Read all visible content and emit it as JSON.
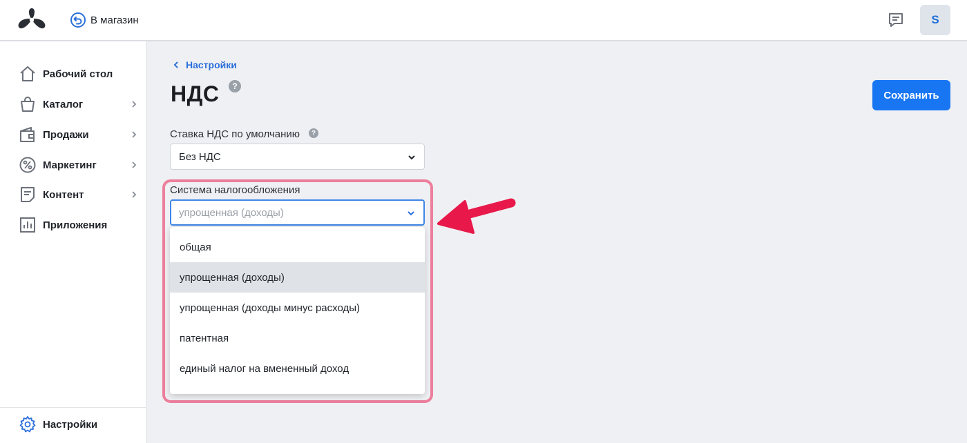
{
  "header": {
    "store_link": "В магазин",
    "avatar_initial": "S"
  },
  "sidebar": {
    "items": [
      {
        "label": "Рабочий стол",
        "icon": "home-icon",
        "has_submenu": false
      },
      {
        "label": "Каталог",
        "icon": "shopping-bag-icon",
        "has_submenu": true
      },
      {
        "label": "Продажи",
        "icon": "wallet-icon",
        "has_submenu": true
      },
      {
        "label": "Маркетинг",
        "icon": "percent-icon",
        "has_submenu": true
      },
      {
        "label": "Контент",
        "icon": "document-icon",
        "has_submenu": true
      },
      {
        "label": "Приложения",
        "icon": "bar-chart-icon",
        "has_submenu": false
      }
    ],
    "settings_label": "Настройки"
  },
  "main": {
    "breadcrumb": "Настройки",
    "title": "НДС",
    "help_glyph": "?",
    "save_label": "Сохранить",
    "vat_rate": {
      "label": "Ставка НДС по умолчанию",
      "value": "Без НДС"
    },
    "tax_system": {
      "label": "Система налогообложения",
      "value": "упрощенная (доходы)",
      "options": [
        "общая",
        "упрощенная (доходы)",
        "упрощенная (доходы минус расходы)",
        "патентная",
        "единый налог на вмененный доход"
      ],
      "selected_index": 1
    }
  },
  "colors": {
    "accent": "#1976f2",
    "highlight": "#ec7f9c",
    "arrow": "#e8194a"
  }
}
